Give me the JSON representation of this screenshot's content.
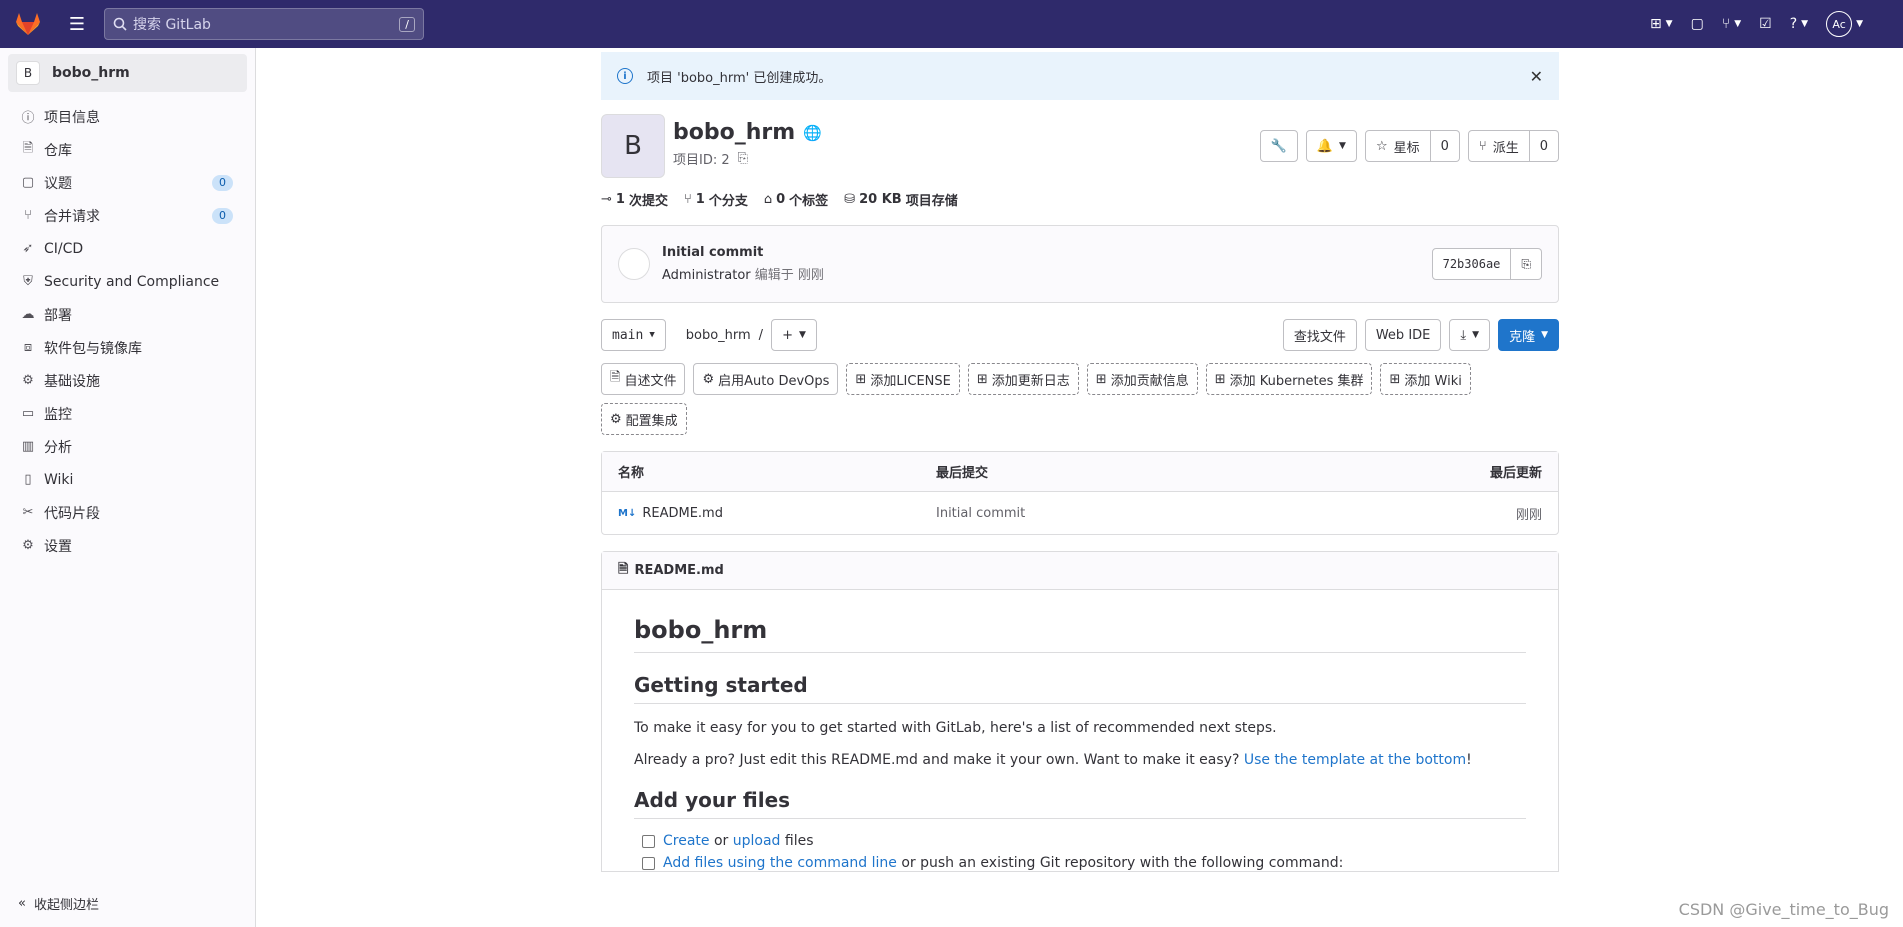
{
  "topbar": {
    "search_placeholder": "搜索 GitLab",
    "search_kbd": "/",
    "avatar_initials": "Ac"
  },
  "sidebar": {
    "project_initial": "B",
    "project_name": "bobo_hrm",
    "items": [
      {
        "label": "项目信息",
        "icon": "info-icon"
      },
      {
        "label": "仓库",
        "icon": "doc-icon"
      },
      {
        "label": "议题",
        "icon": "issues-icon",
        "badge": "0"
      },
      {
        "label": "合并请求",
        "icon": "merge-request-icon",
        "badge": "0"
      },
      {
        "label": "CI/CD",
        "icon": "rocket-icon"
      },
      {
        "label": "Security and Compliance",
        "icon": "shield-icon"
      },
      {
        "label": "部署",
        "icon": "deploy-icon"
      },
      {
        "label": "软件包与镜像库",
        "icon": "package-icon"
      },
      {
        "label": "基础设施",
        "icon": "infrastructure-icon"
      },
      {
        "label": "监控",
        "icon": "monitor-icon"
      },
      {
        "label": "分析",
        "icon": "chart-icon"
      },
      {
        "label": "Wiki",
        "icon": "book-icon"
      },
      {
        "label": "代码片段",
        "icon": "snippet-icon"
      },
      {
        "label": "设置",
        "icon": "gear-icon"
      }
    ],
    "collapse_label": "收起侧边栏"
  },
  "alert": {
    "message": "项目 'bobo_hrm' 已创建成功。"
  },
  "project": {
    "initial": "B",
    "name": "bobo_hrm",
    "id_label": "项目ID: 2",
    "star_label": "星标",
    "star_count": "0",
    "fork_label": "派生",
    "fork_count": "0"
  },
  "stats": {
    "commits_num": "1",
    "commits_label": "次提交",
    "branches_num": "1",
    "branches_label": "个分支",
    "tags_num": "0",
    "tags_label": "个标签",
    "storage_num": "20 KB",
    "storage_label": "项目存储"
  },
  "commit": {
    "title": "Initial commit",
    "author": "Administrator",
    "meta": "编辑于 刚刚",
    "sha": "72b306ae"
  },
  "toolbar": {
    "branch": "main",
    "crumb_project": "bobo_hrm",
    "crumb_sep": "/",
    "find_file": "查找文件",
    "web_ide": "Web IDE",
    "clone": "克隆"
  },
  "quick_actions": [
    {
      "label": "自述文件",
      "icon": "file-icon",
      "style": "solid"
    },
    {
      "label": "启用Auto DevOps",
      "icon": "gear-icon",
      "style": "solid"
    },
    {
      "label": "添加LICENSE",
      "icon": "plus-square-icon",
      "style": "dashed"
    },
    {
      "label": "添加更新日志",
      "icon": "plus-square-icon",
      "style": "dashed"
    },
    {
      "label": "添加贡献信息",
      "icon": "plus-square-icon",
      "style": "dashed"
    },
    {
      "label": "添加 Kubernetes 集群",
      "icon": "plus-square-icon",
      "style": "dashed"
    },
    {
      "label": "添加 Wiki",
      "icon": "plus-square-icon",
      "style": "dashed"
    },
    {
      "label": "配置集成",
      "icon": "gear-icon",
      "style": "dashed"
    }
  ],
  "file_table": {
    "headers": [
      "名称",
      "最后提交",
      "最后更新"
    ],
    "rows": [
      {
        "name": "README.md",
        "commit": "Initial commit",
        "updated": "刚刚"
      }
    ]
  },
  "readme": {
    "filename": "README.md",
    "h1": "bobo_hrm",
    "h2_getting_started": "Getting started",
    "p1": "To make it easy for you to get started with GitLab, here's a list of recommended next steps.",
    "p2_text": "Already a pro? Just edit this README.md and make it your own. Want to make it easy?",
    "p2_link": "Use the template at the bottom",
    "p2_tail": "!",
    "h2_add_files": "Add your files",
    "task1_link1": "Create",
    "task1_mid": "or",
    "task1_link2": "upload",
    "task1_tail": "files",
    "task2_link": "Add files using the command line",
    "task2_tail": "or push an existing Git repository with the following command:"
  },
  "watermark": "CSDN @Give_time_to_Bug",
  "colors": {
    "topbar": "#2f2a6b",
    "primary": "#1f75cb",
    "alert_bg": "#e9f3fc"
  }
}
